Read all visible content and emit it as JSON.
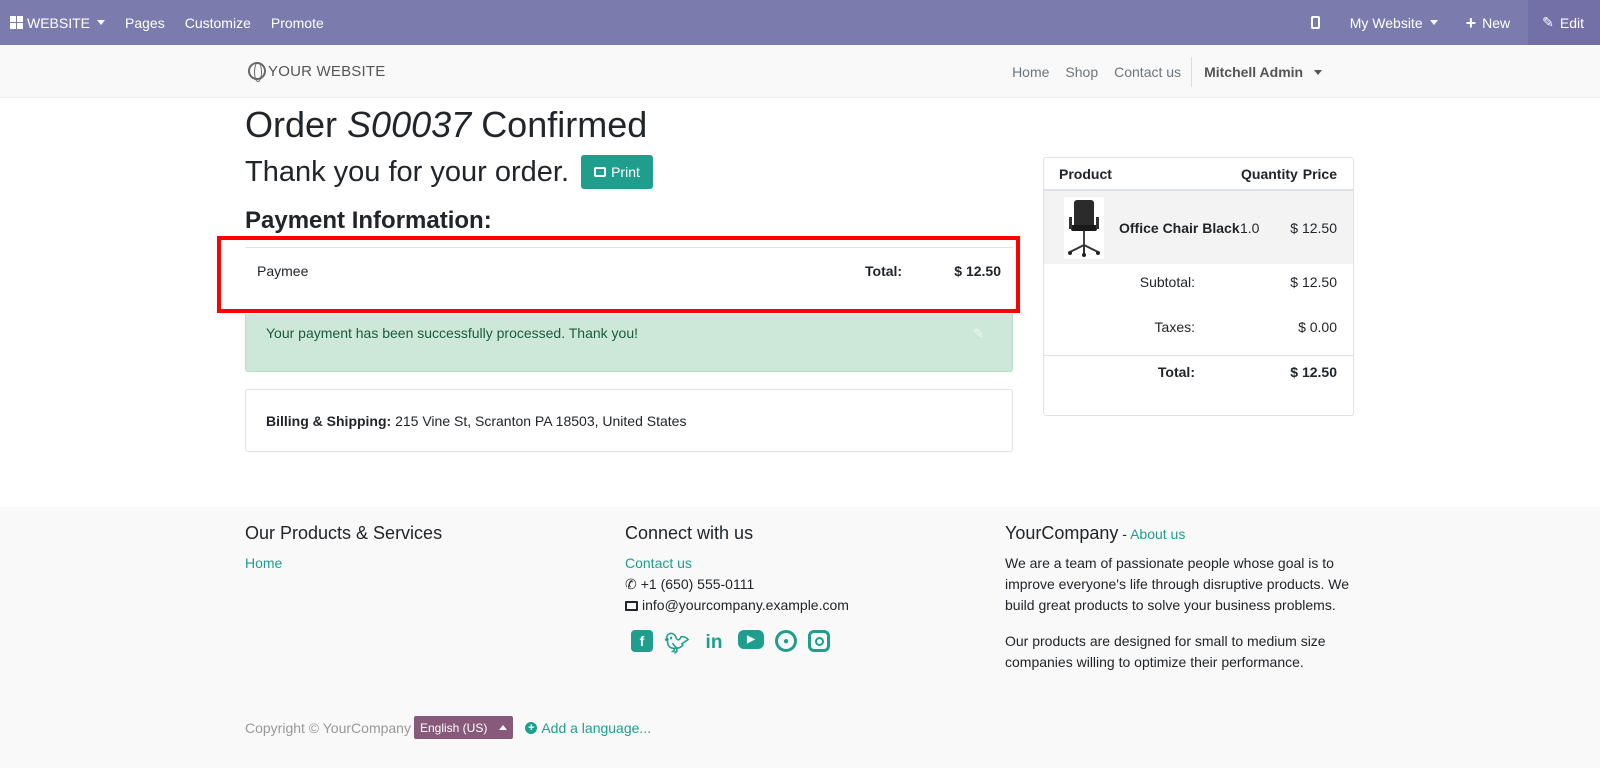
{
  "adminbar": {
    "app": "WEBSITE",
    "menu": [
      "Pages",
      "Customize",
      "Promote"
    ],
    "website_selector": "My Website",
    "new_label": "New",
    "edit_label": "Edit"
  },
  "header": {
    "logo": "YOUR WEBSITE",
    "nav": [
      "Home",
      "Shop",
      "Contact us"
    ],
    "user": "Mitchell Admin"
  },
  "order": {
    "title_prefix": "Order",
    "number": "S00037",
    "title_suffix": "Confirmed",
    "thanks": "Thank you for your order.",
    "print_label": "Print"
  },
  "payment": {
    "heading": "Payment Information:",
    "method": "Paymee",
    "total_label": "Total:",
    "total_value": "$ 12.50",
    "success_message": "Your payment has been successfully processed. Thank you!"
  },
  "billing": {
    "label": "Billing & Shipping:",
    "address": "215 Vine St, Scranton PA 18503, United States"
  },
  "cart": {
    "columns": [
      "Product",
      "Quantity",
      "Price"
    ],
    "line": {
      "name": "Office Chair Black",
      "qty": "1.0",
      "price": "$ 12.50"
    },
    "subtotal_label": "Subtotal:",
    "subtotal_value": "$ 12.50",
    "taxes_label": "Taxes:",
    "taxes_value": "$ 0.00",
    "total_label": "Total:",
    "total_value": "$ 12.50"
  },
  "footer": {
    "col1": {
      "heading": "Our Products & Services",
      "link": "Home"
    },
    "col2": {
      "heading": "Connect with us",
      "link": "Contact us",
      "phone": "+1 (650) 555-0111",
      "email": "info@yourcompany.example.com",
      "socials": [
        "facebook-icon",
        "twitter-icon",
        "linkedin-icon",
        "youtube-icon",
        "github-icon",
        "instagram-icon"
      ]
    },
    "col3": {
      "company": "YourCompany",
      "separator": " - ",
      "about": "About us",
      "p1": "We are a team of passionate people whose goal is to improve everyone's life through disruptive products. We build great products to solve your business problems.",
      "p2": "Our products are designed for small to medium size companies willing to optimize their performance."
    },
    "copyright": "Copyright © YourCompany",
    "language": "English (US)",
    "add_language": "Add a language..."
  },
  "colors": {
    "adminbar": "#7c7bad",
    "accent": "#1f9d8d",
    "success_bg": "#cde7d8",
    "language_badge": "#875a7b",
    "highlight": "#ff0000"
  }
}
